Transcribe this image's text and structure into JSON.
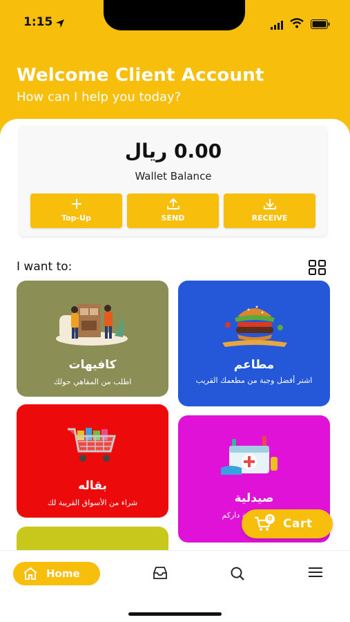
{
  "status_bar": {
    "time": "1:15"
  },
  "header": {
    "title": "Welcome Client Account",
    "subtitle": "How can I help you today?"
  },
  "wallet": {
    "balance": "0.00 ريال",
    "label": "Wallet Balance",
    "actions": [
      {
        "label": "Top-Up",
        "icon": "plus-icon"
      },
      {
        "label": "SEND",
        "icon": "upload-icon"
      },
      {
        "label": "RECEIVE",
        "icon": "download-icon"
      }
    ]
  },
  "section": {
    "label": "I want to:",
    "icon": "grid-view-icon"
  },
  "categories": [
    {
      "title": "كافيهات",
      "description": "اطلب من المقاهي حولك",
      "color": "#8b8e55"
    },
    {
      "title": "مطاعم",
      "description": "اشتر أفضل وجبة من مطعمك القريب",
      "color": "#2458d8"
    },
    {
      "title": "بقاله",
      "description": "شراء من الأسواق القريبة لك",
      "color": "#ec0a0a"
    },
    {
      "title": "صيدلية",
      "description": "ك وتوصيلها بة داركم",
      "color": "#e112d8"
    }
  ],
  "cart": {
    "label": "Cart",
    "count": "0"
  },
  "bottom_nav": {
    "items": [
      {
        "label": "Home",
        "icon": "home-icon",
        "active": true
      },
      {
        "icon": "inbox-icon"
      },
      {
        "icon": "search-icon"
      },
      {
        "icon": "menu-icon"
      }
    ]
  },
  "colors": {
    "accent": "#f7be0c"
  }
}
